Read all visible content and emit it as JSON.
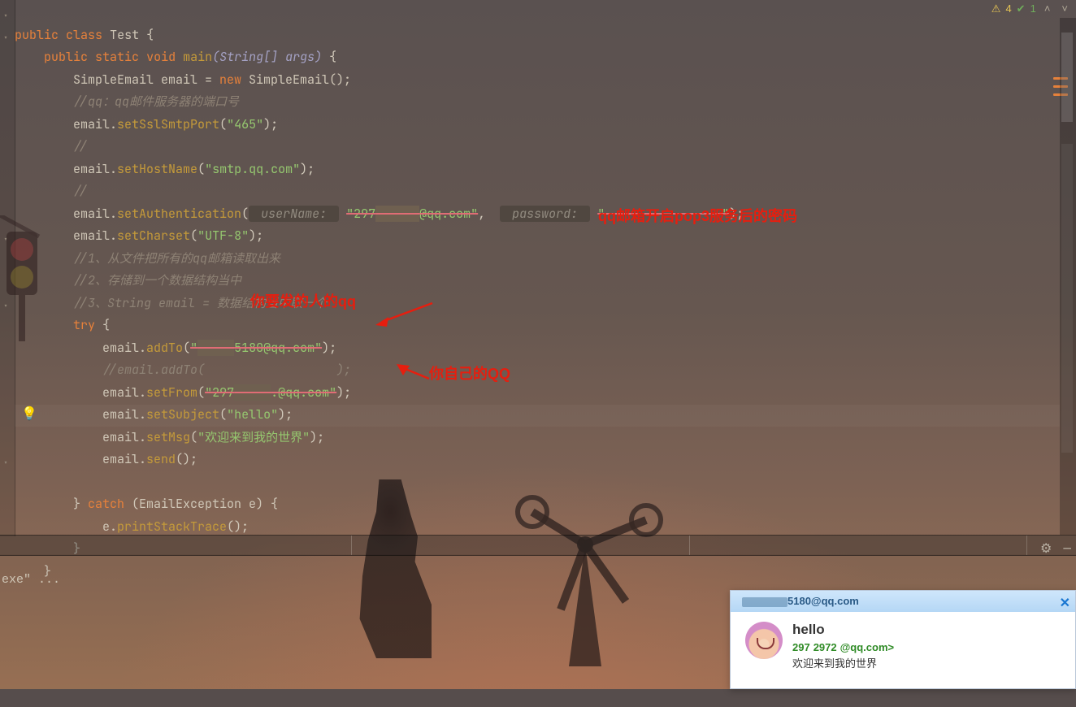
{
  "status": {
    "warnings": "4",
    "ok": "1"
  },
  "code": {
    "l1": {
      "public": "public",
      "class": "class",
      "Test": "Test"
    },
    "l2": {
      "public": "public",
      "static": "static",
      "void": "void",
      "main": "main",
      "args": "(String[] args) {"
    },
    "l3": {
      "t": "SimpleEmail email = ",
      "new": "new",
      "rest": " SimpleEmail();"
    },
    "l4": "//qq：qq邮件服务器的端口号",
    "l5": {
      "a": "email.",
      "m": "setSslSmtpPort",
      "b": "(",
      "s": "\"465\"",
      "c": ");"
    },
    "l6": "//",
    "l7": {
      "a": "email.",
      "m": "setHostName",
      "b": "(",
      "s": "\"smtp.qq.com\"",
      "c": ");"
    },
    "l8": "//",
    "l9": {
      "a": "email.",
      "m": "setAuthentication",
      "b": "(",
      "h1": " userName: ",
      "s1": "\"297",
      "s1b": "@qq.com\"",
      "comma": ", ",
      "h2": " password: ",
      "s2": "\"                \"",
      "c": ");"
    },
    "l10": {
      "a": "email.",
      "m": "setCharset",
      "b": "(",
      "s": "\"UTF-8\"",
      "c": ");"
    },
    "l11": "//1、从文件把所有的qq邮箱读取出来",
    "l12": "//2、存储到一个数据结构当中",
    "l13": "//3、String email = 数据结构当中取一个",
    "l14": {
      "try": "try",
      "brace": " {"
    },
    "l15": {
      "a": "email.",
      "m": "addTo",
      "b": "(",
      "s1": "\"",
      "s2": "5180@qq.com\"",
      "c": ");"
    },
    "l16": "//email.addTo(                  );",
    "l17": {
      "a": "email.",
      "m": "setFrom",
      "b": "(",
      "s1": "\"297",
      "s2": ".@qq.com\"",
      "c": ");"
    },
    "l18": {
      "a": "email.",
      "m": "setSubject",
      "b": "(",
      "s": "\"hello\"",
      "c": ");"
    },
    "l19": {
      "a": "email.",
      "m": "setMsg",
      "b": "(",
      "s": "\"欢迎来到我的世界\"",
      "c": ");"
    },
    "l20": {
      "a": "email.",
      "m": "send",
      "b": "();"
    },
    "l21": "",
    "l22": {
      "brace": "} ",
      "catch": "catch",
      "rest": " (EmailException e) {"
    },
    "l23": {
      "a": "e.",
      "m": "printStackTrace",
      "b": "();"
    },
    "l24": "}",
    "l25": "}"
  },
  "console": "exe\" ...",
  "annotations": {
    "a1": "qq邮箱开启pop3服务后的密码",
    "a2": "你要发的人的qq",
    "a3": "你自己的QQ"
  },
  "popup": {
    "from_addr_tail": "5180@qq.com",
    "subject": "hello",
    "sender_prefix": "297",
    "sender_suffix": "@qq.com>",
    "sender_mid_a": "        ",
    "sender_mid_b": "2972",
    "sender_mid_c": "       ",
    "body": "欢迎来到我的世界"
  }
}
